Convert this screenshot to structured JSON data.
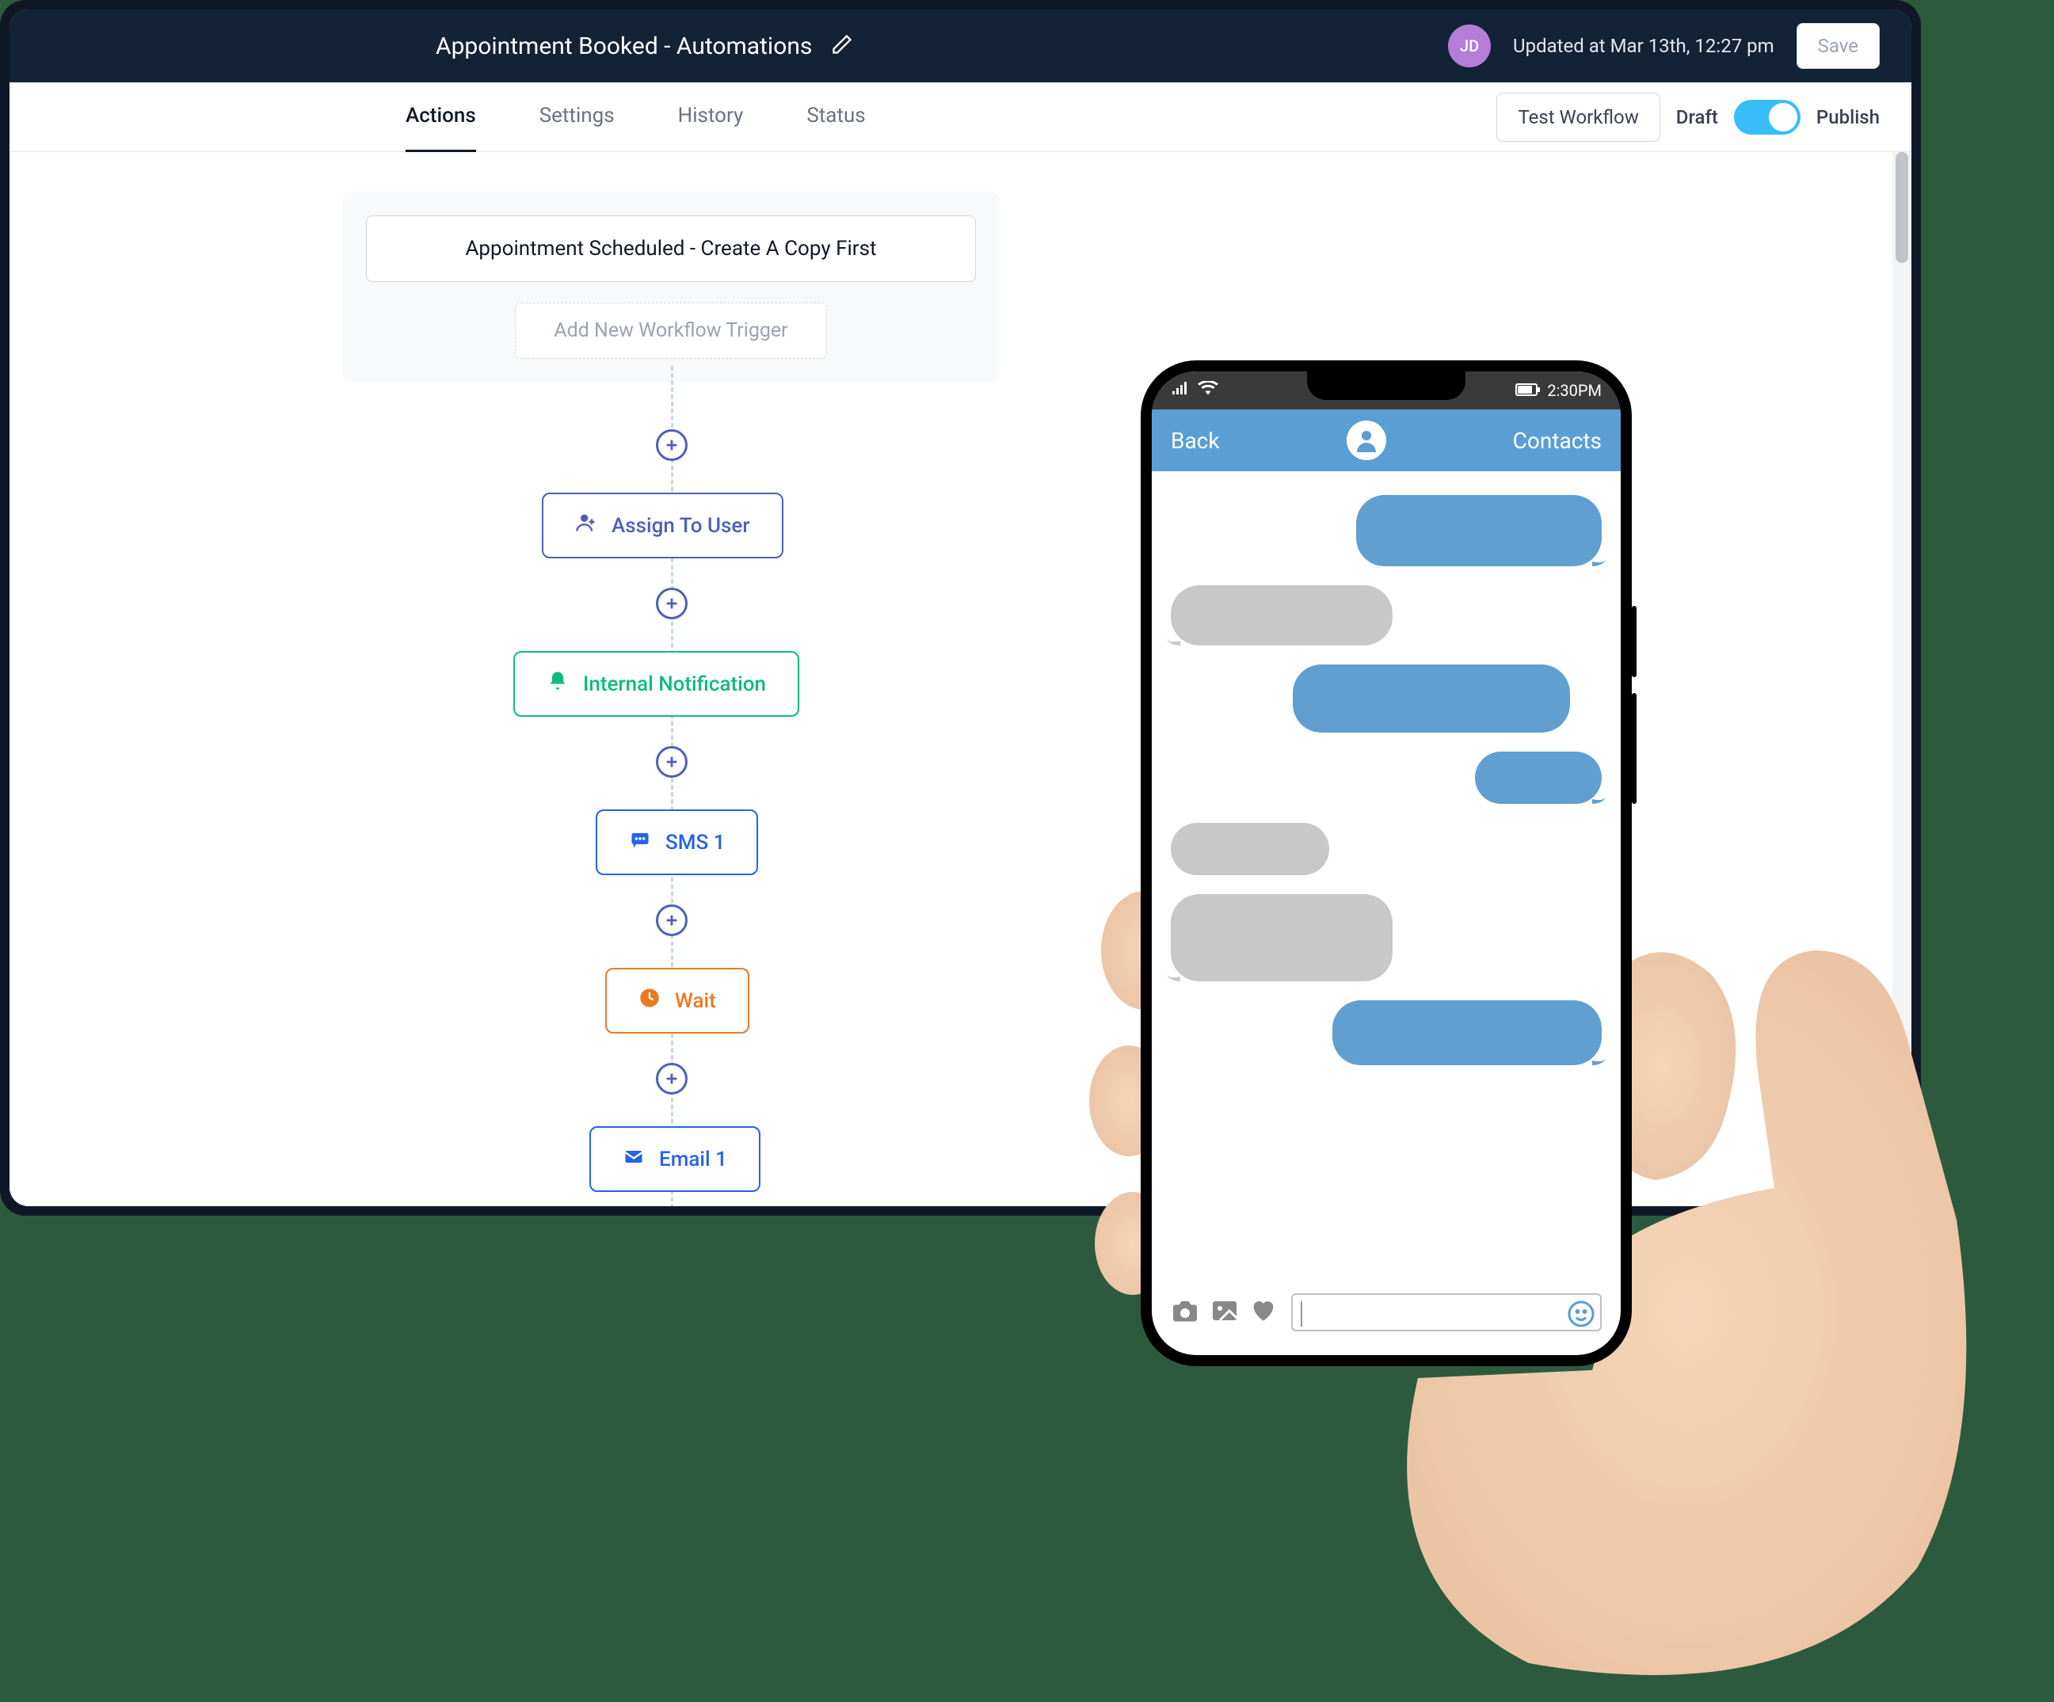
{
  "header": {
    "title": "Appointment Booked - Automations",
    "avatar_initials": "JD",
    "updated_text": "Updated at Mar 13th, 12:27 pm",
    "save_label": "Save"
  },
  "tabs": {
    "items": [
      "Actions",
      "Settings",
      "History",
      "Status"
    ],
    "active": "Actions"
  },
  "toolbar": {
    "test_label": "Test Workflow",
    "draft_label": "Draft",
    "publish_label": "Publish"
  },
  "trigger": {
    "title": "Appointment Scheduled - Create A Copy First",
    "add_label": "Add New Workflow Trigger"
  },
  "nodes": {
    "assign": {
      "label": "Assign To User",
      "color": "#4f5fb8",
      "icon": "user-assign"
    },
    "notify": {
      "label": "Internal Notification",
      "color": "#10b981",
      "icon": "bell"
    },
    "sms": {
      "label": "SMS 1",
      "color": "#2563eb",
      "icon": "sms"
    },
    "wait": {
      "label": "Wait",
      "color": "#ea7a1f",
      "icon": "clock"
    },
    "email": {
      "label": "Email 1",
      "color": "#2563eb",
      "icon": "mail"
    }
  },
  "phone": {
    "status_time": "2:30PM",
    "nav_back": "Back",
    "nav_contacts": "Contacts"
  }
}
